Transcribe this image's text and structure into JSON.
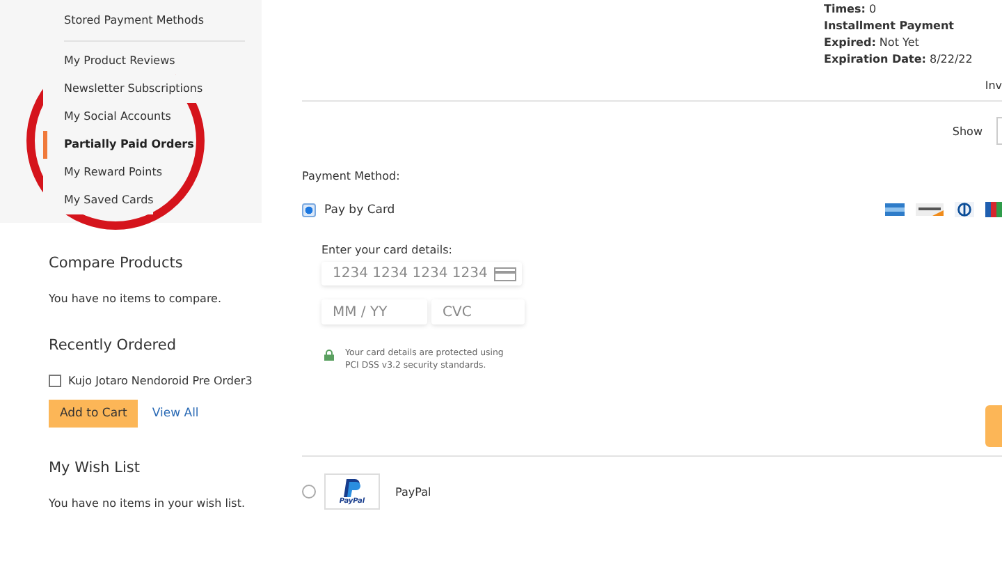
{
  "account_nav": {
    "items": [
      {
        "label": "Stored Payment Methods",
        "selected": false
      },
      {
        "label": "My Product Reviews",
        "selected": false
      },
      {
        "label": "Newsletter Subscriptions",
        "selected": false
      },
      {
        "label": "My Social Accounts",
        "selected": false
      },
      {
        "label": "Partially Paid Orders",
        "selected": true
      },
      {
        "label": "My Reward Points",
        "selected": false
      },
      {
        "label": "My Saved Cards",
        "selected": false
      }
    ]
  },
  "compare": {
    "title": "Compare Products",
    "message": "You have no items to compare."
  },
  "recently_ordered": {
    "title": "Recently Ordered",
    "items": [
      {
        "label": "Kujo Jotaro Nendoroid Pre Order3",
        "checked": false
      }
    ],
    "add_button": "Add to Cart",
    "view_all": "View All"
  },
  "wish_list": {
    "title": "My Wish List",
    "message": "You have no items in your wish list."
  },
  "order_info": [
    {
      "label": "Times:",
      "value": "0"
    },
    {
      "label": "Installment Payment"
    },
    {
      "label": "Expired:",
      "value": "Not Yet"
    },
    {
      "label": "Expiration Date:",
      "value": "8/22/22"
    }
  ],
  "cut_link": "Inv",
  "show_label": "Show",
  "payment": {
    "title": "Payment Method:",
    "methods": [
      {
        "kind": "card",
        "label": "Pay by Card",
        "selected": true
      },
      {
        "kind": "paypal",
        "label": "PayPal",
        "selected": false,
        "logo_text": "PayPal"
      }
    ],
    "card_form": {
      "title": "Enter your card details:",
      "number_placeholder": "1234 1234 1234 1234",
      "expiry_placeholder": "MM / YY",
      "cvc_placeholder": "CVC",
      "notice": "Your card details are protected using PCI DSS v3.2 security standards."
    }
  }
}
